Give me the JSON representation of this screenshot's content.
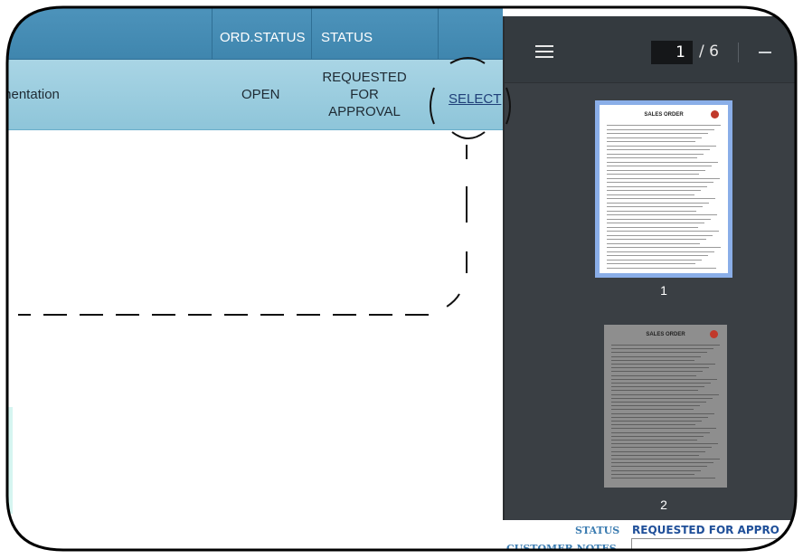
{
  "table": {
    "headers": {
      "ord_status": "ORD.STATUS",
      "status": "STATUS"
    },
    "row": {
      "description": "mentation",
      "ord_status": "OPEN",
      "status_lines": [
        "REQUESTED",
        "FOR",
        "APPROVAL"
      ],
      "action": "SELECT"
    }
  },
  "viewer": {
    "current_page": "1",
    "page_separator": "/ 6",
    "thumbnails": [
      {
        "title": "SALES ORDER",
        "number": "1",
        "selected": true
      },
      {
        "title": "SALES ORDER",
        "number": "2",
        "selected": false
      }
    ]
  },
  "fields": {
    "status_label": "STATUS",
    "status_value": "REQUESTED FOR APPRO",
    "notes_label": "CUSTOMER NOTES",
    "notes_value": ""
  },
  "colors": {
    "header_blue": "#4f95bd",
    "row_blue": "#a9d5e5",
    "viewer_bg": "#3a3f44",
    "thumb_selected": "#8aaee8",
    "label_blue": "#3a7bb0",
    "value_blue": "#1f4f99"
  }
}
